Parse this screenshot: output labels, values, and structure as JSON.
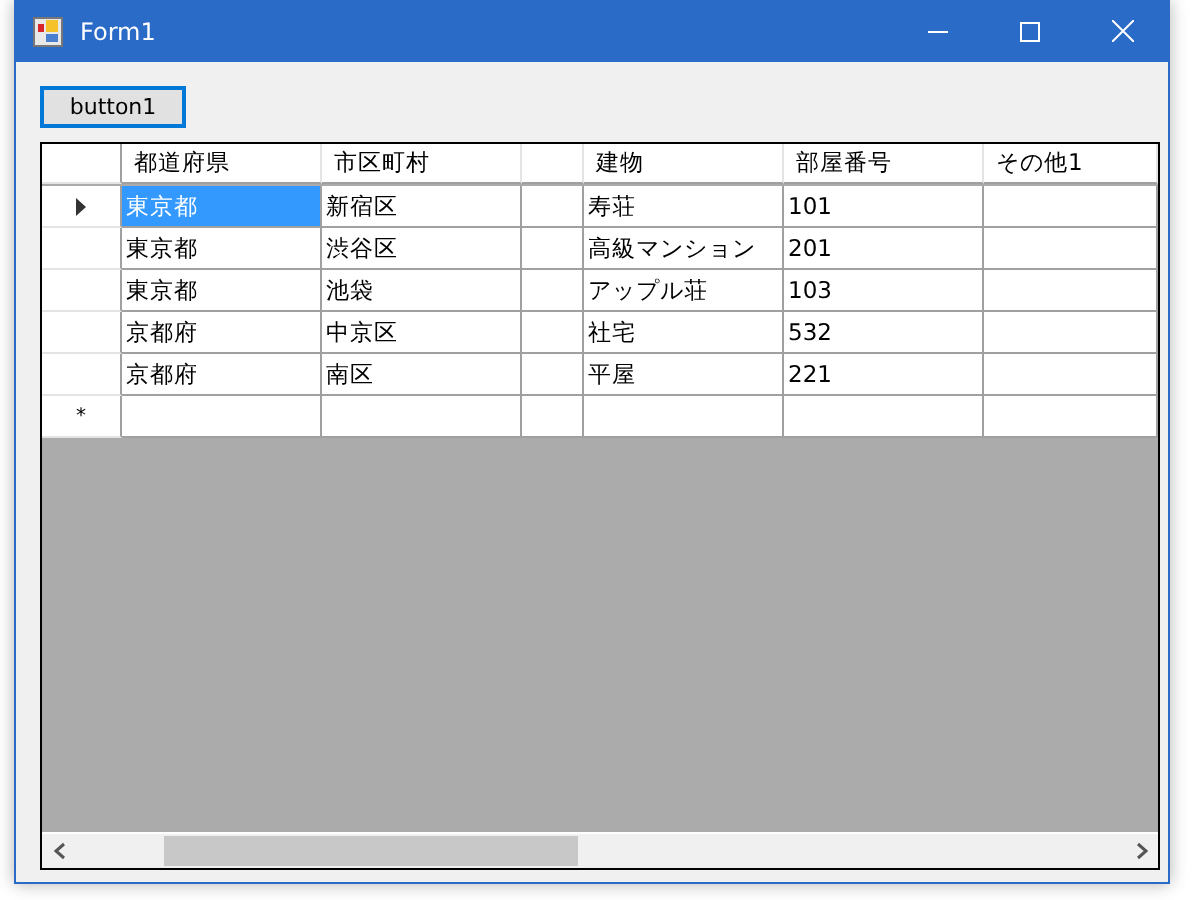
{
  "window": {
    "title": "Form1"
  },
  "button": {
    "label": "button1",
    "focused": true
  },
  "grid": {
    "columns": [
      {
        "kind": "text",
        "label": "都道府県"
      },
      {
        "kind": "text",
        "label": "市区町村"
      },
      {
        "kind": "blank"
      },
      {
        "kind": "text",
        "label": "建物"
      },
      {
        "kind": "text",
        "label": "部屋番号"
      },
      {
        "kind": "text",
        "label": "その他1"
      }
    ],
    "rows": [
      {
        "kind": "data",
        "current": true,
        "cells": [
          {
            "text": "東京都",
            "selected": true
          },
          {
            "text": "新宿区",
            "selected": false
          },
          {
            "selected": false
          },
          {
            "text": "寿荘",
            "selected": false
          },
          {
            "text": "101",
            "selected": false
          },
          {
            "selected": false
          }
        ]
      },
      {
        "kind": "data",
        "current": false,
        "cells": [
          {
            "text": "東京都",
            "selected": false
          },
          {
            "text": "渋谷区",
            "selected": false
          },
          {
            "selected": false
          },
          {
            "text": "高級マンション",
            "selected": false
          },
          {
            "text": "201",
            "selected": false
          },
          {
            "selected": false
          }
        ]
      },
      {
        "kind": "data",
        "current": false,
        "cells": [
          {
            "text": "東京都",
            "selected": false
          },
          {
            "text": "池袋",
            "selected": false
          },
          {
            "selected": false
          },
          {
            "text": "アップル荘",
            "selected": false
          },
          {
            "text": "103",
            "selected": false
          },
          {
            "selected": false
          }
        ]
      },
      {
        "kind": "data",
        "current": false,
        "cells": [
          {
            "text": "京都府",
            "selected": false
          },
          {
            "text": "中京区",
            "selected": false
          },
          {
            "selected": false
          },
          {
            "text": "社宅",
            "selected": false
          },
          {
            "text": "532",
            "selected": false
          },
          {
            "selected": false
          }
        ]
      },
      {
        "kind": "data",
        "current": false,
        "cells": [
          {
            "text": "京都府",
            "selected": false
          },
          {
            "text": "南区",
            "selected": false
          },
          {
            "selected": false
          },
          {
            "text": "平屋",
            "selected": false
          },
          {
            "text": "221",
            "selected": false
          },
          {
            "selected": false
          }
        ]
      },
      {
        "kind": "new",
        "current": false,
        "marker": "*",
        "cells": [
          {
            "selected": false
          },
          {
            "selected": false
          },
          {
            "selected": false
          },
          {
            "selected": false
          },
          {
            "selected": false
          },
          {
            "selected": false
          }
        ]
      }
    ]
  }
}
